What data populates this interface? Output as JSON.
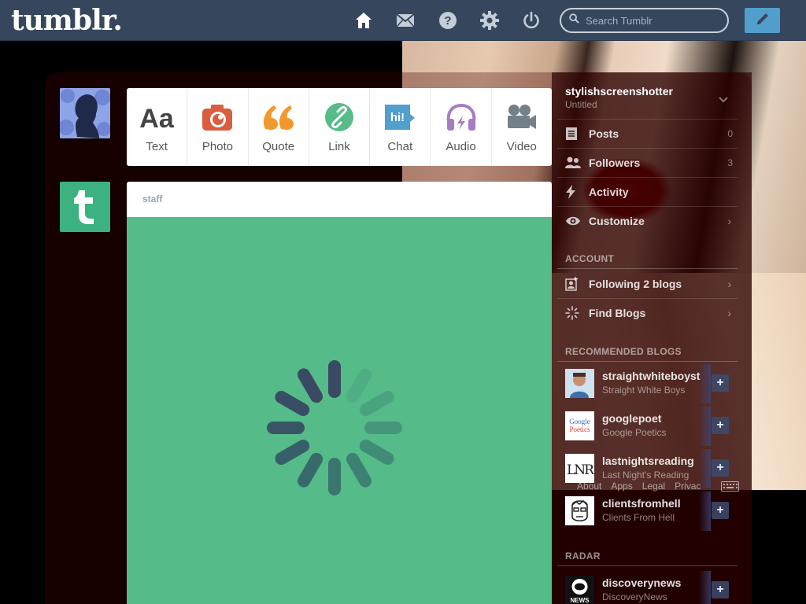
{
  "header": {
    "logo": "tumblr.",
    "search_placeholder": "Search Tumblr",
    "nav_icons": [
      "home-icon",
      "mail-icon",
      "help-icon",
      "gear-icon",
      "power-icon"
    ],
    "compose_icon": "pencil-icon"
  },
  "post_types": [
    {
      "label": "Text",
      "icon": "text-icon",
      "color": "#444444"
    },
    {
      "label": "Photo",
      "icon": "camera-icon",
      "color": "#d95e40"
    },
    {
      "label": "Quote",
      "icon": "quote-icon",
      "color": "#f2992e"
    },
    {
      "label": "Link",
      "icon": "link-icon",
      "color": "#56bc8a"
    },
    {
      "label": "Chat",
      "icon": "chat-icon",
      "color": "#529ecc"
    },
    {
      "label": "Audio",
      "icon": "headphones-icon",
      "color": "#a77dc2"
    },
    {
      "label": "Video",
      "icon": "video-camera-icon",
      "color": "#748089"
    }
  ],
  "post": {
    "author": "staff",
    "body_color": "#55bb89"
  },
  "sidebar": {
    "blog_name": "stylishscreenshotter",
    "blog_subtitle": "Untitled",
    "items": [
      {
        "label": "Posts",
        "count": "0",
        "icon": "posts-icon"
      },
      {
        "label": "Followers",
        "count": "3",
        "icon": "followers-icon"
      },
      {
        "label": "Activity",
        "count": "",
        "icon": "lightning-icon"
      },
      {
        "label": "Customize",
        "count": "",
        "icon": "eye-icon"
      }
    ],
    "account_heading": "ACCOUNT",
    "account_items": [
      {
        "label": "Following 2 blogs",
        "icon": "following-icon"
      },
      {
        "label": "Find Blogs",
        "icon": "find-blogs-icon"
      }
    ],
    "recommended_heading": "RECOMMENDED BLOGS",
    "recommended": [
      {
        "name": "straightwhiteboyst",
        "subtitle": "Straight White Boys"
      },
      {
        "name": "googlepoet",
        "subtitle": "Google Poetics",
        "avatar_text": "Google Poetics"
      },
      {
        "name": "lastnightsreading",
        "subtitle": "Last Night's Reading",
        "avatar_text": "LNR"
      },
      {
        "name": "clientsfromhell",
        "subtitle": "Clients From Hell"
      }
    ],
    "radar_heading": "RADAR",
    "radar": [
      {
        "name": "discoverynews",
        "subtitle": "DiscoveryNews",
        "avatar_text": "NEWS"
      }
    ],
    "add_label": "+"
  },
  "footer": {
    "links": [
      "About",
      "Apps",
      "Legal",
      "Privac"
    ]
  }
}
